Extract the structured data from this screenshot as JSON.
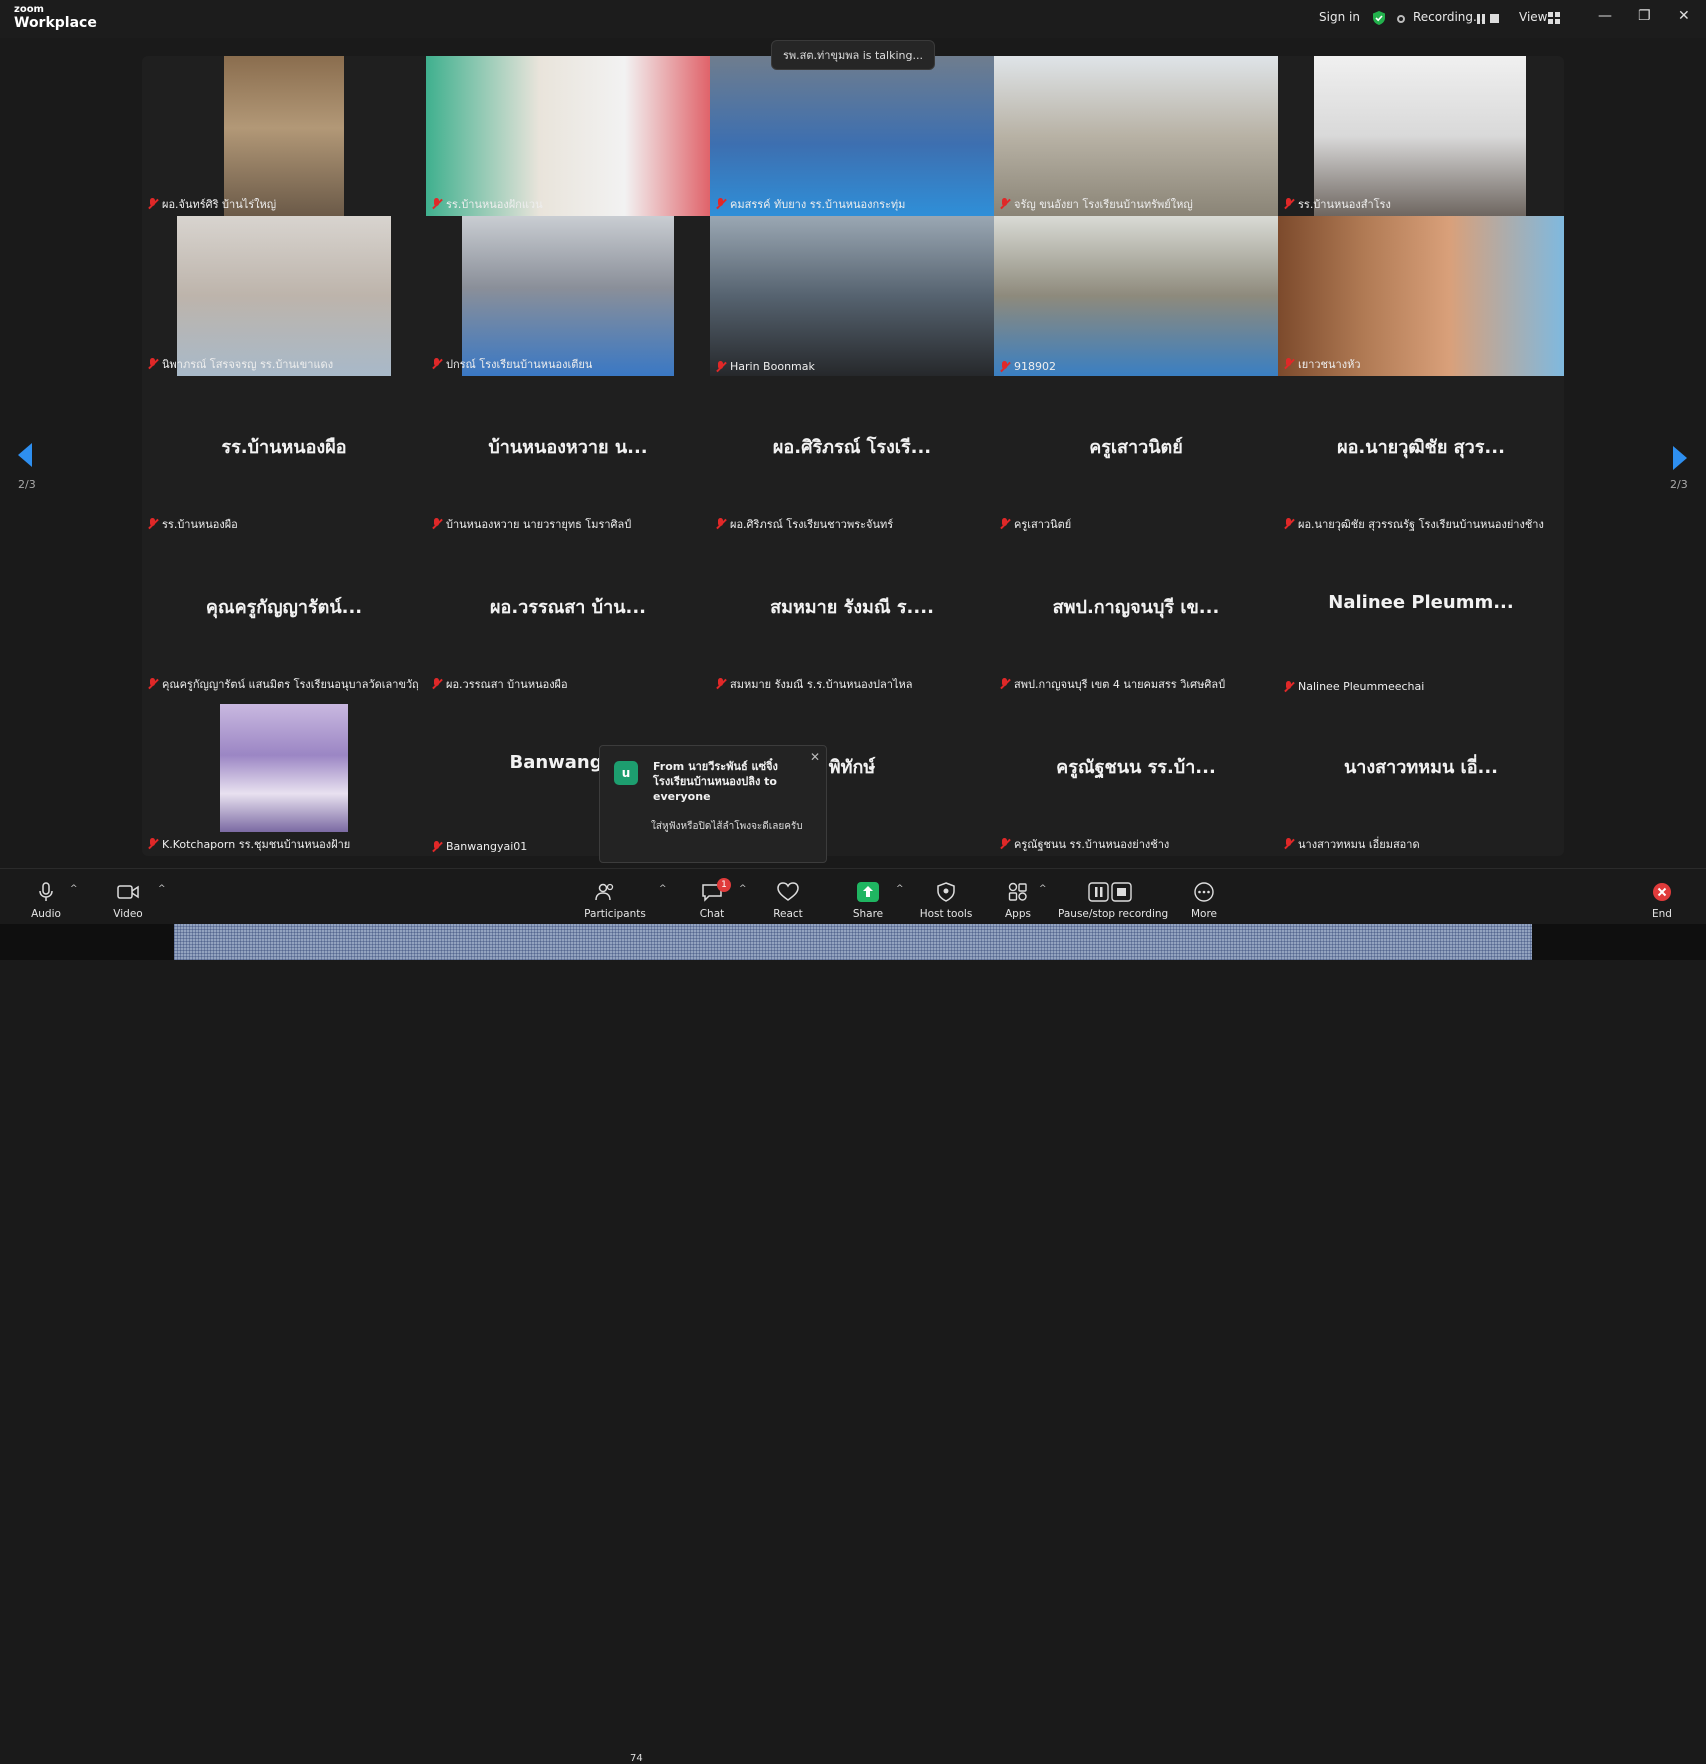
{
  "app": {
    "brand_top": "zoom",
    "brand_bottom": "Workplace"
  },
  "topbar": {
    "sign_in": "Sign in",
    "recording": "Recording...",
    "view": "View"
  },
  "talking_indicator": "รพ.สต.ท่าขุมพล is talking...",
  "pagination": {
    "left": "2/3",
    "right": "2/3"
  },
  "rows": [
    [
      {
        "label": "ผอ.จันทร์ศิริ บ้านไร่ใหญ่",
        "video": true
      },
      {
        "label": "รร.บ้านหนองฝักแวน",
        "video": true
      },
      {
        "label": "คมสรรค์ ทับยาง รร.บ้านหนองกระทุ่ม",
        "video": true
      },
      {
        "label": "จรัญ ขนอังยา โรงเรียนบ้านทรัพย์ใหญ่",
        "video": true
      },
      {
        "label": "รร.บ้านหนองสำโรง",
        "video": true
      }
    ],
    [
      {
        "label": "นิพาภรณ์ โสรจจรญ รร.บ้านเขาแดง",
        "video": true
      },
      {
        "label": "ปกรณ์ โรงเรียนบ้านหนองเตียน",
        "video": true
      },
      {
        "label": "Harin Boonmak",
        "video": true
      },
      {
        "label": "918902",
        "video": true
      },
      {
        "label": "เยาวชนางหัว",
        "video": true
      }
    ],
    [
      {
        "name": "รร.บ้านหนองผือ",
        "label": "รร.บ้านหนองผือ"
      },
      {
        "name": "บ้านหนองหวาย น...",
        "label": "บ้านหนองหวาย นายวรายุทธ โมราศิลป์"
      },
      {
        "name": "ผอ.ศิริภรณ์ โรงเรี...",
        "label": "ผอ.ศิริภรณ์ โรงเรียนชาวพระจันทร์"
      },
      {
        "name": "ครูเสาวนิตย์",
        "label": "ครูเสาวนิตย์"
      },
      {
        "name": "ผอ.นายวุฒิชัย สุวร...",
        "label": "ผอ.นายวุฒิชัย สุวรรณรัฐ โรงเรียนบ้านหนองย่างช้าง"
      }
    ],
    [
      {
        "name": "คุณครูกัญญารัตน์...",
        "label": "คุณครูกัญญารัตน์ แสนมิตร โรงเรียนอนุบาลวัดเลาขวัญ"
      },
      {
        "name": "ผอ.วรรณสา บ้าน...",
        "label": "ผอ.วรรณสา บ้านหนองผือ"
      },
      {
        "name": "สมหมาย รังมณี ร....",
        "label": "สมหมาย รังมณี ร.ร.บ้านหนองปลาไหล"
      },
      {
        "name": "สพป.กาญจนบุรี เข...",
        "label": "สพป.กาญจนบุรี เขต 4 นายคมสรร วิเศษศิลป์"
      },
      {
        "name": "Nalinee Pleumm...",
        "label": "Nalinee Pleummeechai"
      }
    ],
    [
      {
        "label": "K.Kotchaporn รร.ชุมชนบ้านหนองฝ้าย",
        "video": true
      },
      {
        "name": "Banwangya",
        "label": "Banwangyai01"
      },
      {
        "name": "พิทักษ์",
        "label": ""
      },
      {
        "name": "ครูณัฐชนน รร.บ้า...",
        "label": "ครูณัฐชนน รร.บ้านหนองย่างช้าง"
      },
      {
        "name": "นางสาวทหมน เอี่...",
        "label": "นางสาวทหมน เอี่ยมสอาด"
      }
    ]
  ],
  "chat_popup": {
    "avatar_letter": "u",
    "from": "From นายวีระพันธ์ แซ่จิ๋ง โรงเรียนบ้านหนองปลิง to everyone",
    "message": "ใส่หูฟังหรือปิดไส้ลำโพงจะดีเลยครับ"
  },
  "toolbar": {
    "audio": "Audio",
    "video": "Video",
    "participants": "Participants",
    "participants_count": "74",
    "chat": "Chat",
    "chat_badge": "1",
    "react": "React",
    "share": "Share",
    "host_tools": "Host tools",
    "apps": "Apps",
    "pause_stop_recording": "Pause/stop recording",
    "more": "More",
    "end": "End"
  },
  "colors": {
    "accent": "#2e8ff0",
    "mute_red": "#e02828",
    "share_green": "#1fb561",
    "end_red": "#e03b3b"
  }
}
